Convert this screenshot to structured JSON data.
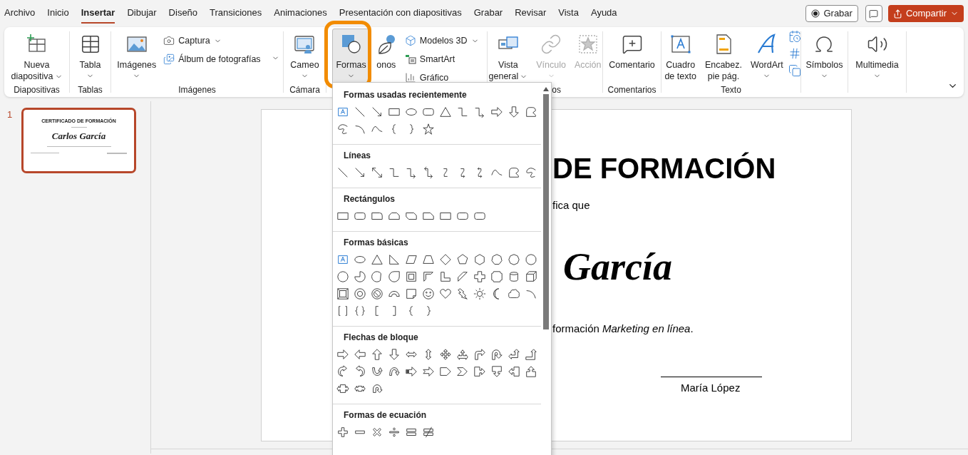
{
  "menu_tabs": [
    {
      "label": "Archivo",
      "selected": false
    },
    {
      "label": "Inicio",
      "selected": false
    },
    {
      "label": "Insertar",
      "selected": true
    },
    {
      "label": "Dibujar",
      "selected": false
    },
    {
      "label": "Diseño",
      "selected": false
    },
    {
      "label": "Transiciones",
      "selected": false
    },
    {
      "label": "Animaciones",
      "selected": false
    },
    {
      "label": "Presentación con diapositivas",
      "selected": false
    },
    {
      "label": "Grabar",
      "selected": false
    },
    {
      "label": "Revisar",
      "selected": false
    },
    {
      "label": "Vista",
      "selected": false
    },
    {
      "label": "Ayuda",
      "selected": false
    }
  ],
  "header_actions": {
    "record_button": "Grabar",
    "share_button": "Compartir"
  },
  "ribbon_groups": [
    {
      "label": "Diapositivas",
      "controls": [
        {
          "kind": "large",
          "lines": [
            "Nueva",
            "diapositiva"
          ],
          "dropdown": true,
          "pressed": false,
          "disabled": false
        }
      ]
    },
    {
      "label": "Tablas",
      "controls": [
        {
          "kind": "large",
          "lines": [
            "Tabla"
          ],
          "dropdown": true,
          "pressed": false,
          "disabled": false
        }
      ]
    },
    {
      "label": "Imágenes",
      "controls": [
        {
          "kind": "large",
          "lines": [
            "Imágenes"
          ],
          "dropdown": true,
          "pressed": false,
          "disabled": false
        },
        {
          "kind": "stack",
          "expander": true,
          "items": [
            {
              "label": "Captura",
              "dropdown": true
            },
            {
              "label": "Álbum de fotografías",
              "dropdown": false
            }
          ]
        }
      ]
    },
    {
      "label": "Cámara",
      "controls": [
        {
          "kind": "large",
          "lines": [
            "Cameo"
          ],
          "dropdown": true,
          "pressed": false,
          "disabled": false
        }
      ]
    },
    {
      "controls": [
        {
          "kind": "large",
          "lines": [
            "Formas"
          ],
          "dropdown": true,
          "pressed": true,
          "disabled": false
        },
        {
          "kind": "large",
          "lines": [
            "onos"
          ],
          "dropdown": false,
          "pressed": false,
          "disabled": false
        },
        {
          "kind": "stack",
          "expander": false,
          "items": [
            {
              "label": "Modelos 3D",
              "dropdown": true
            },
            {
              "label": "SmartArt",
              "dropdown": false
            },
            {
              "label": "Gráfico",
              "dropdown": false
            }
          ]
        }
      ]
    },
    {
      "label": "os",
      "controls": [
        {
          "kind": "large",
          "lines": [
            "Vista",
            "general"
          ],
          "dropdown": true,
          "pressed": false,
          "disabled": false
        },
        {
          "kind": "large",
          "lines": [
            "Vínculo"
          ],
          "dropdown": true,
          "pressed": false,
          "disabled": true
        },
        {
          "kind": "large",
          "lines": [
            "Acción"
          ],
          "dropdown": false,
          "pressed": false,
          "disabled": true
        }
      ]
    },
    {
      "label": "Comentarios",
      "controls": [
        {
          "kind": "large",
          "lines": [
            "Comentario"
          ],
          "dropdown": false,
          "pressed": false,
          "disabled": false
        }
      ]
    },
    {
      "label": "Texto",
      "controls": [
        {
          "kind": "large",
          "lines": [
            "Cuadro",
            "de texto"
          ],
          "dropdown": false,
          "pressed": false,
          "disabled": false
        },
        {
          "kind": "large",
          "lines": [
            "Encabez.",
            "pie pág."
          ],
          "dropdown": false,
          "pressed": false,
          "disabled": false
        },
        {
          "kind": "large",
          "lines": [
            "WordArt"
          ],
          "dropdown": true,
          "pressed": false,
          "disabled": false
        },
        {
          "kind": "icon_stack"
        }
      ]
    },
    {
      "controls": [
        {
          "kind": "large",
          "lines": [
            "Símbolos"
          ],
          "dropdown": true,
          "pressed": false,
          "disabled": false
        }
      ]
    },
    {
      "controls": [
        {
          "kind": "large",
          "lines": [
            "Multimedia"
          ],
          "dropdown": true,
          "pressed": false,
          "disabled": false
        }
      ]
    }
  ],
  "slide_thumbnail": {
    "number": "1",
    "selected": true,
    "title": "CERTIFICADO DE FORMACIÓN",
    "name": "Carlos García"
  },
  "slide": {
    "title": "DE FORMACIÓN",
    "line_1": "fica que",
    "name": "García",
    "line_2": "formación *Marketing en línea*.",
    "signatory": "María López"
  },
  "shapes_gallery": {
    "sections": [
      {
        "title": "Formas usadas recientemente"
      },
      {
        "title": "Líneas"
      },
      {
        "title": "Rectángulos"
      },
      {
        "title": "Formas básicas"
      },
      {
        "title": "Flechas de bloque"
      },
      {
        "title": "Formas de ecuación"
      }
    ]
  }
}
